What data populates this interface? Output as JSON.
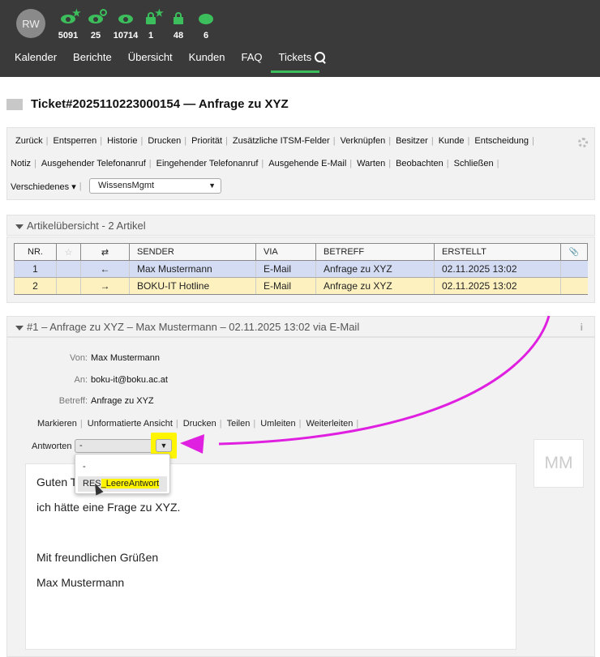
{
  "user": {
    "initials": "RW"
  },
  "stats": [
    {
      "icon": "eye-star-icon",
      "value": "5091"
    },
    {
      "icon": "eye-clock-icon",
      "value": "25"
    },
    {
      "icon": "eye-icon",
      "value": "10714"
    },
    {
      "icon": "lock-star-icon",
      "value": "1"
    },
    {
      "icon": "lock-icon",
      "value": "48"
    },
    {
      "icon": "chat-bubble-icon",
      "value": "6"
    }
  ],
  "nav": [
    "Kalender",
    "Berichte",
    "Übersicht",
    "Kunden",
    "FAQ",
    "Tickets"
  ],
  "active_nav": "Tickets",
  "ticket": {
    "title": "Ticket#2025110223000154 — Anfrage zu XYZ"
  },
  "actions_row1": [
    "Zurück",
    "Entsperren",
    "Historie",
    "Drucken",
    "Priorität",
    "Zusätzliche ITSM-Felder",
    "Verknüpfen",
    "Besitzer",
    "Kunde",
    "Entscheidung"
  ],
  "actions_row2": [
    "Notiz",
    "Ausgehender Telefonanruf",
    "Eingehender Telefonanruf",
    "Ausgehende E-Mail",
    "Warten",
    "Beobachten",
    "Schließen"
  ],
  "actions_row3": {
    "misc_label": "Verschiedenes ▾",
    "select_value": "WissensMgmt"
  },
  "article_overview": {
    "header": "Artikelübersicht - 2 Artikel",
    "columns": [
      "NR.",
      "☆",
      "⇄",
      "SENDER",
      "VIA",
      "BETREFF",
      "ERSTELLT",
      "📎"
    ],
    "rows": [
      {
        "nr": "1",
        "dir": "←",
        "sender": "Max Mustermann",
        "via": "E-Mail",
        "subject": "Anfrage zu XYZ",
        "created": "02.11.2025 13:02"
      },
      {
        "nr": "2",
        "dir": "→",
        "sender": "BOKU-IT Hotline",
        "via": "E-Mail",
        "subject": "Anfrage zu XYZ",
        "created": "02.11.2025 13:02"
      }
    ]
  },
  "article": {
    "header": "#1 – Anfrage zu XYZ – Max Mustermann – 02.11.2025 13:02 via E-Mail",
    "from_label": "Von:",
    "from": "Max Mustermann",
    "to_label": "An:",
    "to": "boku-it@boku.ac.at",
    "subject_label": "Betreff:",
    "subject": "Anfrage zu XYZ",
    "actions": [
      "Markieren",
      "Unformatierte Ansicht",
      "Drucken",
      "Teilen",
      "Umleiten",
      "Weiterleiten"
    ],
    "reply_label": "Antworten",
    "reply_value": "-",
    "reply_options": [
      "-",
      "RES_LeereAntwort"
    ],
    "body": [
      "Guten T",
      "ich hätte eine Frage zu XYZ.",
      "Mit freundlichen Grüßen",
      "Max Mustermann"
    ],
    "avatar_initials": "MM"
  },
  "colors": {
    "accent": "#3dbe5c",
    "highlight": "#fff500",
    "annotation": "#e020e0",
    "row_selected": "#d4dcf4",
    "row_highlight": "#fdf1c0"
  }
}
